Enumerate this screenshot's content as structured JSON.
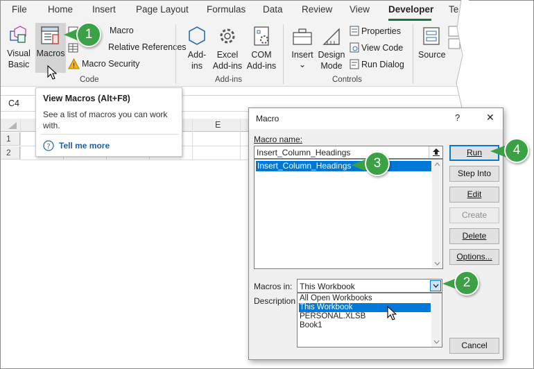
{
  "ribbon": {
    "tabs": [
      "File",
      "Home",
      "Insert",
      "Page Layout",
      "Formulas",
      "Data",
      "Review",
      "View",
      "Developer",
      "Te"
    ],
    "visual_basic": [
      "Visual",
      "Basic"
    ],
    "macros": "Macros",
    "record_macro": "Macro",
    "relative_references": "Relative References",
    "macro_security": "Macro Security",
    "group_code": "Code",
    "addins": [
      "Add-",
      "ins"
    ],
    "excel_addins": [
      "Excel",
      "Add-ins"
    ],
    "com_addins": [
      "COM",
      "Add-ins"
    ],
    "group_addins": "Add-ins",
    "insert": "Insert",
    "design_mode": [
      "Design",
      "Mode"
    ],
    "properties": "Properties",
    "view_code": "View Code",
    "run_dialog": "Run Dialog",
    "group_controls": "Controls",
    "source": "Source"
  },
  "namebox": "C4",
  "columns": [
    "E"
  ],
  "rows": [
    "1",
    "2"
  ],
  "tooltip": {
    "title": "View Macros (Alt+F8)",
    "description": "See a list of macros you can work with.",
    "link": "Tell me more"
  },
  "dialog": {
    "title": "Macro",
    "help": "?",
    "close": "✕",
    "macro_name_label": "Macro name:",
    "macro_name_value": "Insert_Column_Headings",
    "macro_list": [
      "Insert_Column_Headings"
    ],
    "macros_in_label": "Macros in:",
    "macros_in_value": "This Workbook",
    "macros_in_options": [
      "All Open Workbooks",
      "This Workbook",
      "PERSONAL.XLSB",
      "Book1"
    ],
    "description_label": "Description",
    "buttons": {
      "run": "Run",
      "step_into": "Step Into",
      "edit": "Edit",
      "create": "Create",
      "delete": "Delete",
      "options": "Options...",
      "cancel": "Cancel"
    }
  },
  "callouts": [
    "1",
    "2",
    "3",
    "4"
  ],
  "colors": {
    "accent": "#0078d7",
    "selection": "#0078d7",
    "callout": "#3aa244",
    "excel_green": "#1e7145"
  }
}
